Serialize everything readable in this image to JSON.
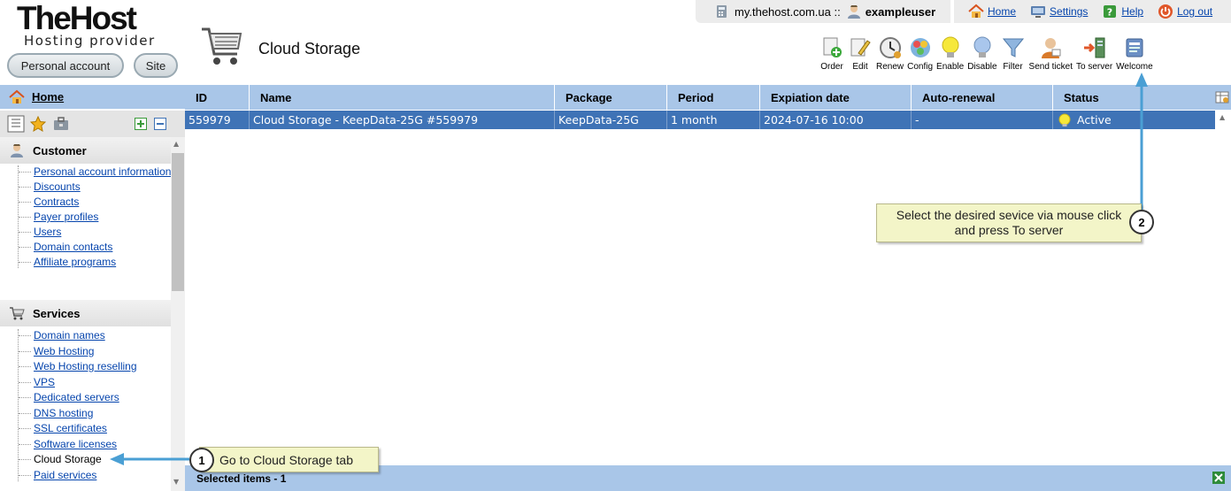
{
  "brand": {
    "name": "TheHost",
    "tagline": "Hosting provider"
  },
  "header_buttons": {
    "personal_account": "Personal account",
    "site": "Site"
  },
  "page": {
    "title": "Cloud Storage"
  },
  "topbar": {
    "domain": "my.thehost.com.ua ::",
    "username": "exampleuser",
    "links": {
      "home": "Home",
      "settings": "Settings",
      "help": "Help",
      "logout": "Log out"
    }
  },
  "toolbar": {
    "order": "Order",
    "edit": "Edit",
    "renew": "Renew",
    "config": "Config",
    "enable": "Enable",
    "disable": "Disable",
    "filter": "Filter",
    "send_ticket": "Send ticket",
    "to_server": "To server",
    "welcome": "Welcome"
  },
  "sidebar": {
    "home": "Home",
    "customer": {
      "title": "Customer",
      "items": [
        "Personal account information",
        "Discounts",
        "Contracts",
        "Payer profiles",
        "Users",
        "Domain contacts",
        "Affiliate programs"
      ]
    },
    "services": {
      "title": "Services",
      "items": [
        "Domain names",
        "Web Hosting",
        "Web Hosting reselling",
        "VPS",
        "Dedicated servers",
        "DNS hosting",
        "SSL certificates",
        "Software licenses",
        "Cloud Storage",
        "Paid services"
      ]
    }
  },
  "grid": {
    "columns": {
      "id": "ID",
      "name": "Name",
      "package": "Package",
      "period": "Period",
      "expiration": "Expiation date",
      "auto_renewal": "Auto-renewal",
      "status": "Status"
    },
    "rows": [
      {
        "id": "559979",
        "name": "Cloud Storage - KeepData-25G #559979",
        "package": "KeepData-25G",
        "period": "1 month",
        "expiration": "2024-07-16 10:00",
        "auto_renewal": "-",
        "status": "Active"
      }
    ],
    "footer": "Selected items - 1"
  },
  "callouts": {
    "one": {
      "number": "1",
      "text": "Go to Cloud Storage tab"
    },
    "two": {
      "number": "2",
      "line1": "Select the desired sevice via mouse click",
      "line2": "and press To server"
    }
  },
  "colors": {
    "header_blue": "#a9c6e8",
    "selected_row": "#3f73b6",
    "callout_bg": "#f3f5c8",
    "arrow": "#4a9fd4"
  }
}
